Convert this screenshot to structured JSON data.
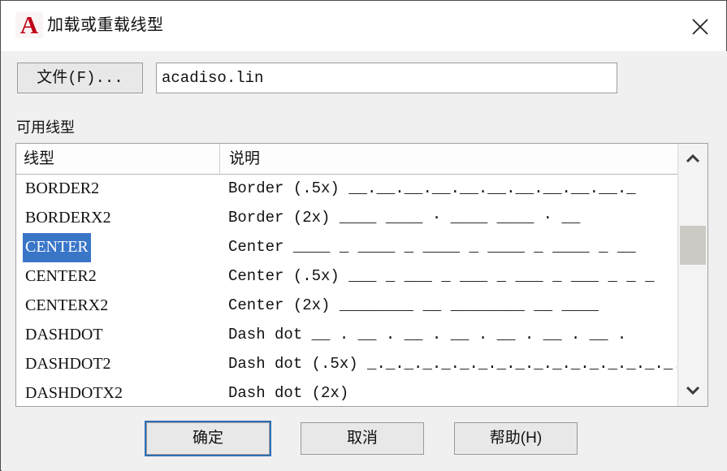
{
  "window": {
    "logo_letter": "A",
    "logo_icon": "autocad-logo-icon",
    "title": "加载或重载线型",
    "close_icon": "close-icon",
    "accent_color": "#3a76c8",
    "logo_color": "#c00418"
  },
  "file_row": {
    "button_label": "文件(F)...",
    "input_value": "acadiso.lin",
    "input_placeholder": ""
  },
  "available_section": {
    "label": "可用线型"
  },
  "list": {
    "columns": [
      {
        "key": "name",
        "label": "线型"
      },
      {
        "key": "desc",
        "label": "说明"
      }
    ],
    "selected_index": 2,
    "rows": [
      {
        "name": "BORDER2",
        "desc": "Border (.5x)",
        "pattern": "__.__.__.__.__.__.__.__.__.__._"
      },
      {
        "name": "BORDERX2",
        "desc": "Border (2x)",
        "pattern": "____  ____  ·   ____   ____   ·   __"
      },
      {
        "name": "CENTER",
        "desc": "Center",
        "pattern": "____ _ ____ _ ____ _ ____ _ ____ _ __"
      },
      {
        "name": "CENTER2",
        "desc": "Center (.5x)",
        "pattern": "___ _ ___ _ ___ _ ___ _ ___ _ _ _"
      },
      {
        "name": "CENTERX2",
        "desc": "Center (2x)",
        "pattern": "________  __  ________  __  ____"
      },
      {
        "name": "DASHDOT",
        "desc": "Dash dot",
        "pattern": "__ . __ . __ . __ . __ . __ . __ ."
      },
      {
        "name": "DASHDOT2",
        "desc": "Dash dot (.5x)",
        "pattern": "_._._._._._._._._._._._._._._._._._"
      },
      {
        "name": "DASHDOTX2",
        "desc": "Dash dot (2x)",
        "pattern": ""
      }
    ]
  },
  "scrollbar": {
    "up_icon": "chevron-up-icon",
    "down_icon": "chevron-down-icon",
    "thumb": "scrollbar-thumb"
  },
  "buttons": {
    "ok": "确定",
    "cancel": "取消",
    "help": "帮助(H)"
  }
}
